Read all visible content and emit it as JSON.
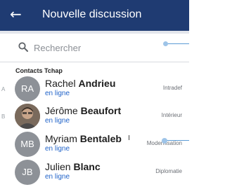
{
  "appbar": {
    "back_glyph": "←",
    "title": "Nouvelle discussion"
  },
  "search": {
    "placeholder": "Rechercher",
    "value": ""
  },
  "section": {
    "title": "Contacts Tchap"
  },
  "alpha_index": [
    "A",
    "B"
  ],
  "contacts": [
    {
      "initials": "RA",
      "first_name": "Rachel",
      "last_name": "Andrieu",
      "status": "en ligne",
      "domain": "Intradef"
    },
    {
      "initials": "",
      "first_name": "Jérôme",
      "last_name": "Beaufort",
      "status": "en ligne",
      "domain": "Intérieur"
    },
    {
      "initials": "MB",
      "first_name": "Myriam",
      "last_name": "Bentaleb",
      "status": "en ligne",
      "domain": "Modernisation"
    },
    {
      "initials": "JB",
      "first_name": "Julien",
      "last_name": "Blanc",
      "status": "en ligne",
      "domain": "Diplomatie"
    }
  ],
  "colors": {
    "appbar_bg": "#1f3b72",
    "status_blue": "#1f62c8",
    "avatar_gray": "#8d9197"
  }
}
